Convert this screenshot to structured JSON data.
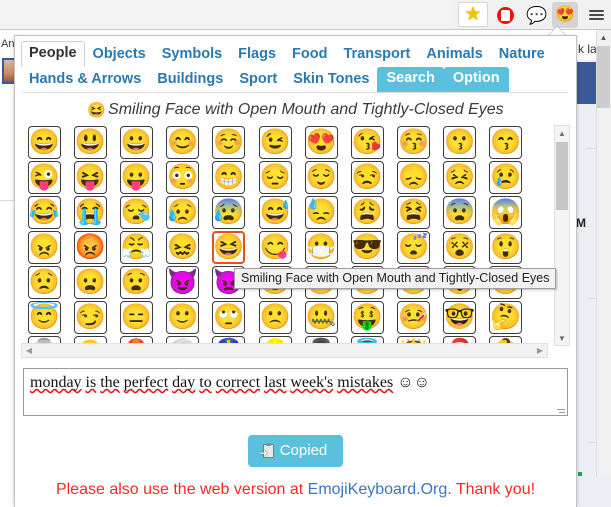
{
  "browser": {
    "toolbar_icons": [
      {
        "name": "bookmark-star-icon",
        "glyph": "★",
        "label": "Bookmark"
      },
      {
        "name": "adblock-icon",
        "glyph": "",
        "label": "AdBlock"
      },
      {
        "name": "speech-balloon-icon",
        "glyph": "💬",
        "label": "Messages"
      },
      {
        "name": "emoji-keyboard-icon",
        "glyph": "😍",
        "label": "Emoji Keyboard"
      },
      {
        "name": "chrome-menu-icon",
        "glyph": "",
        "label": "Menu"
      }
    ]
  },
  "page_behind": {
    "left_text": "An",
    "right_text": "k lain",
    "right_letter": "M"
  },
  "popup": {
    "tabs_row1": [
      {
        "label": "People",
        "state": "active"
      },
      {
        "label": "Objects",
        "state": "link"
      },
      {
        "label": "Symbols",
        "state": "link"
      },
      {
        "label": "Flags",
        "state": "link"
      },
      {
        "label": "Food",
        "state": "link"
      },
      {
        "label": "Transport",
        "state": "link"
      },
      {
        "label": "Animals",
        "state": "link"
      },
      {
        "label": "Nature",
        "state": "link"
      }
    ],
    "tabs_row2": [
      {
        "label": "Hands & Arrows",
        "state": "link"
      },
      {
        "label": "Buildings",
        "state": "link"
      },
      {
        "label": "Sport",
        "state": "link"
      },
      {
        "label": "Skin Tones",
        "state": "link"
      },
      {
        "label": "Search",
        "state": "pill"
      },
      {
        "label": "Option",
        "state": "pill"
      }
    ],
    "title": {
      "emoji": "😆",
      "text": "Smiling Face with Open Mouth and Tightly-Closed Eyes"
    },
    "tooltip": "Smiling Face with Open Mouth and Tightly-Closed Eyes",
    "grid": {
      "columns": 11,
      "selected": {
        "row": 3,
        "col": 4
      },
      "rows": [
        [
          "😄",
          "😃",
          "😀",
          "😊",
          "☺️",
          "😉",
          "😍",
          "😘",
          "😚",
          "😗",
          "😙"
        ],
        [
          "😜",
          "😝",
          "😛",
          "😳",
          "😁",
          "😔",
          "😌",
          "😒",
          "😞",
          "😣",
          "😢"
        ],
        [
          "😂",
          "😭",
          "😪",
          "😥",
          "😰",
          "😅",
          "😓",
          "😩",
          "😫",
          "😨",
          "😱"
        ],
        [
          "😠",
          "😡",
          "😤",
          "😖",
          "😆",
          "😋",
          "😷",
          "😎",
          "😴",
          "😵",
          "😲"
        ],
        [
          "😟",
          "😦",
          "😧",
          "😈",
          "👿",
          "😮",
          "😬",
          "😐",
          "😕",
          "😯",
          "😶"
        ],
        [
          "😇",
          "😏",
          "😑",
          "🙂",
          "🙄",
          "🙁",
          "🤐",
          "🤑",
          "🤒",
          "🤓",
          "🤔"
        ],
        [
          "👵",
          "👴",
          "👲",
          "👳",
          "👮",
          "👷",
          "💂",
          "👼",
          "👸",
          "🎅",
          "👶"
        ]
      ]
    },
    "text_output": {
      "value": "monday is the perfect day to correct last week's mistakes ☺☺",
      "misspelled": [
        "monday",
        "is",
        "the",
        "perfect",
        "day",
        "to",
        "correct",
        "last",
        "week's",
        "mistakes"
      ],
      "trailing_emoji": "☺☺"
    },
    "copy_button": {
      "label": "Copied",
      "icon": "clipboard-paste-icon",
      "color": "#5bc0de"
    },
    "footer": {
      "prefix": "Please also use the web version at ",
      "link": "EmojiKeyboard.Org",
      "suffix": ". Thank you!",
      "color": "#fa2a21",
      "link_color": "#3a74c4"
    },
    "scrollbars": {
      "vertical_up": "▲",
      "vertical_down": "▼",
      "horizontal_left": "◀",
      "horizontal_right": "▶"
    }
  }
}
